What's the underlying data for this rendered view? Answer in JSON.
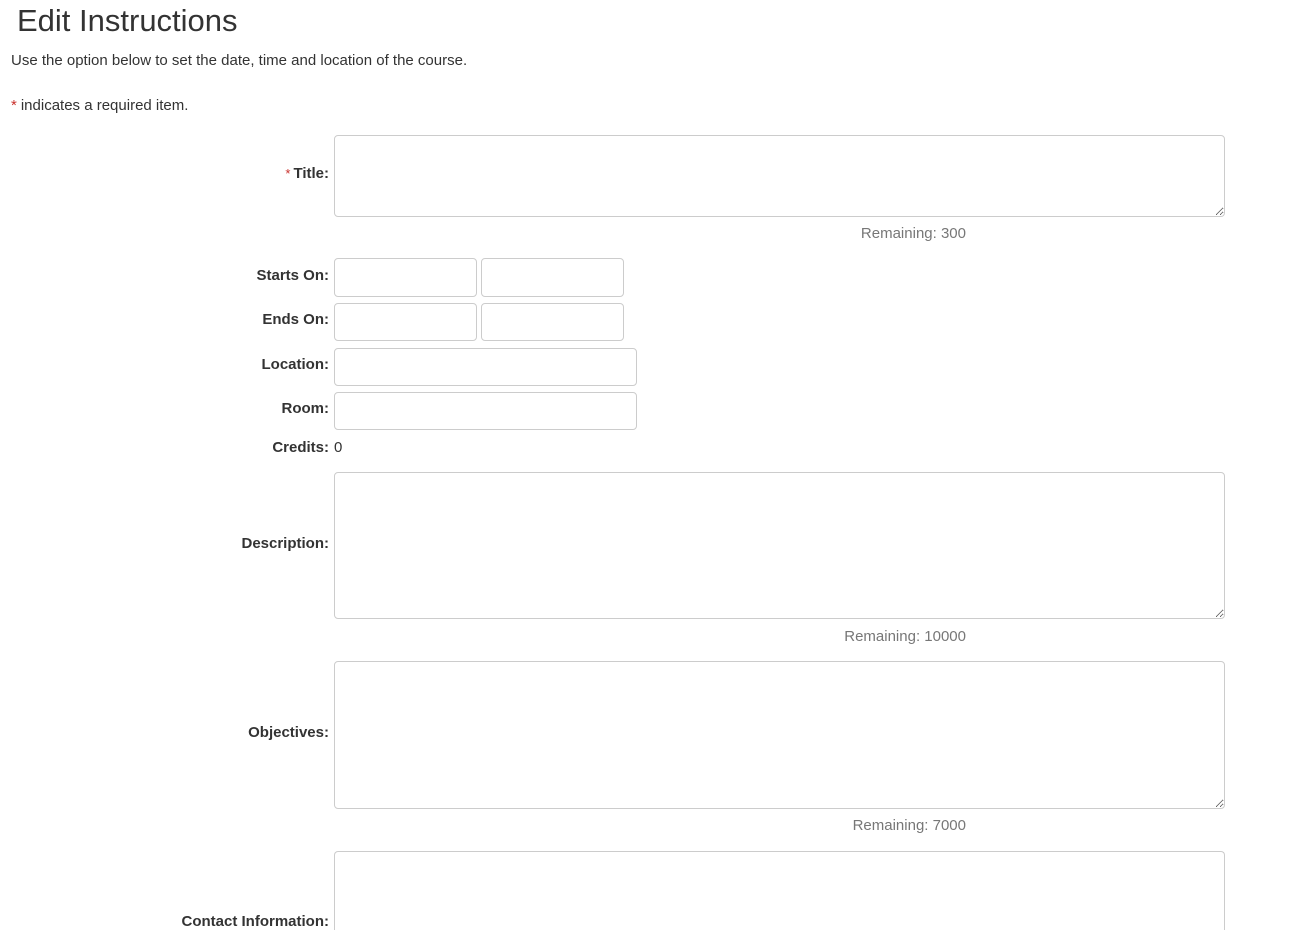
{
  "page": {
    "title": "Edit Instructions",
    "intro": "Use the option below to set the date, time and location of the course.",
    "required_star": "*",
    "required_note": "indicates a required item."
  },
  "form": {
    "title": {
      "label": "Title:",
      "required_star": "*",
      "value": "",
      "remaining": "Remaining: 300"
    },
    "starts_on": {
      "label": "Starts On:",
      "date_value": "",
      "time_value": ""
    },
    "ends_on": {
      "label": "Ends On:",
      "date_value": "",
      "time_value": ""
    },
    "location": {
      "label": "Location:",
      "value": ""
    },
    "room": {
      "label": "Room:",
      "value": ""
    },
    "credits": {
      "label": "Credits:",
      "value": "0"
    },
    "description": {
      "label": "Description:",
      "value": "",
      "remaining": "Remaining: 10000"
    },
    "objectives": {
      "label": "Objectives:",
      "value": "",
      "remaining": "Remaining: 7000"
    },
    "contact_information": {
      "label": "Contact Information:",
      "value": ""
    }
  },
  "colors": {
    "required_star": "#c9302c",
    "text": "#333333",
    "muted": "#777777",
    "border": "#cccccc"
  }
}
